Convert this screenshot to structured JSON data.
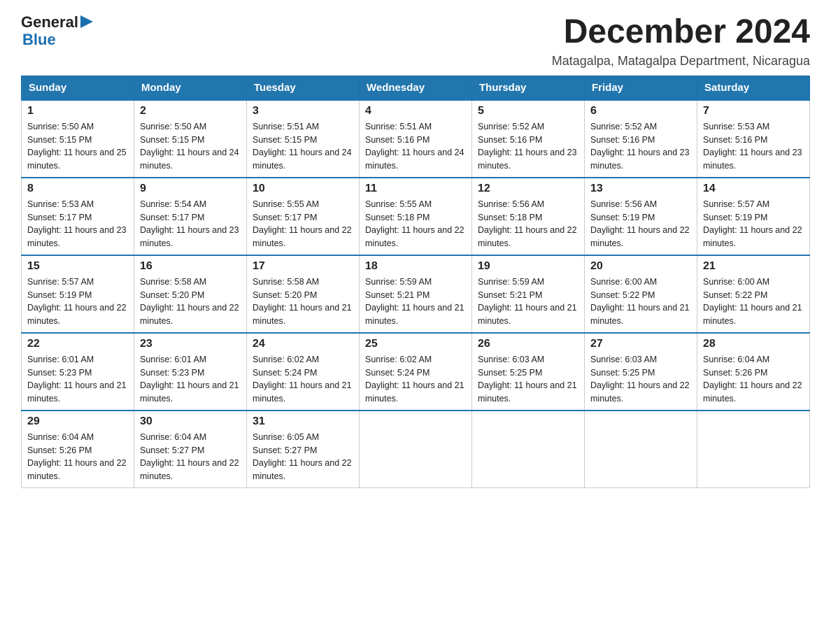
{
  "logo": {
    "text_general": "General",
    "arrow": "▶",
    "text_blue": "Blue"
  },
  "header": {
    "title": "December 2024",
    "subtitle": "Matagalpa, Matagalpa Department, Nicaragua"
  },
  "days_of_week": [
    "Sunday",
    "Monday",
    "Tuesday",
    "Wednesday",
    "Thursday",
    "Friday",
    "Saturday"
  ],
  "weeks": [
    [
      {
        "day": "1",
        "sunrise": "5:50 AM",
        "sunset": "5:15 PM",
        "daylight": "11 hours and 25 minutes."
      },
      {
        "day": "2",
        "sunrise": "5:50 AM",
        "sunset": "5:15 PM",
        "daylight": "11 hours and 24 minutes."
      },
      {
        "day": "3",
        "sunrise": "5:51 AM",
        "sunset": "5:15 PM",
        "daylight": "11 hours and 24 minutes."
      },
      {
        "day": "4",
        "sunrise": "5:51 AM",
        "sunset": "5:16 PM",
        "daylight": "11 hours and 24 minutes."
      },
      {
        "day": "5",
        "sunrise": "5:52 AM",
        "sunset": "5:16 PM",
        "daylight": "11 hours and 23 minutes."
      },
      {
        "day": "6",
        "sunrise": "5:52 AM",
        "sunset": "5:16 PM",
        "daylight": "11 hours and 23 minutes."
      },
      {
        "day": "7",
        "sunrise": "5:53 AM",
        "sunset": "5:16 PM",
        "daylight": "11 hours and 23 minutes."
      }
    ],
    [
      {
        "day": "8",
        "sunrise": "5:53 AM",
        "sunset": "5:17 PM",
        "daylight": "11 hours and 23 minutes."
      },
      {
        "day": "9",
        "sunrise": "5:54 AM",
        "sunset": "5:17 PM",
        "daylight": "11 hours and 23 minutes."
      },
      {
        "day": "10",
        "sunrise": "5:55 AM",
        "sunset": "5:17 PM",
        "daylight": "11 hours and 22 minutes."
      },
      {
        "day": "11",
        "sunrise": "5:55 AM",
        "sunset": "5:18 PM",
        "daylight": "11 hours and 22 minutes."
      },
      {
        "day": "12",
        "sunrise": "5:56 AM",
        "sunset": "5:18 PM",
        "daylight": "11 hours and 22 minutes."
      },
      {
        "day": "13",
        "sunrise": "5:56 AM",
        "sunset": "5:19 PM",
        "daylight": "11 hours and 22 minutes."
      },
      {
        "day": "14",
        "sunrise": "5:57 AM",
        "sunset": "5:19 PM",
        "daylight": "11 hours and 22 minutes."
      }
    ],
    [
      {
        "day": "15",
        "sunrise": "5:57 AM",
        "sunset": "5:19 PM",
        "daylight": "11 hours and 22 minutes."
      },
      {
        "day": "16",
        "sunrise": "5:58 AM",
        "sunset": "5:20 PM",
        "daylight": "11 hours and 22 minutes."
      },
      {
        "day": "17",
        "sunrise": "5:58 AM",
        "sunset": "5:20 PM",
        "daylight": "11 hours and 21 minutes."
      },
      {
        "day": "18",
        "sunrise": "5:59 AM",
        "sunset": "5:21 PM",
        "daylight": "11 hours and 21 minutes."
      },
      {
        "day": "19",
        "sunrise": "5:59 AM",
        "sunset": "5:21 PM",
        "daylight": "11 hours and 21 minutes."
      },
      {
        "day": "20",
        "sunrise": "6:00 AM",
        "sunset": "5:22 PM",
        "daylight": "11 hours and 21 minutes."
      },
      {
        "day": "21",
        "sunrise": "6:00 AM",
        "sunset": "5:22 PM",
        "daylight": "11 hours and 21 minutes."
      }
    ],
    [
      {
        "day": "22",
        "sunrise": "6:01 AM",
        "sunset": "5:23 PM",
        "daylight": "11 hours and 21 minutes."
      },
      {
        "day": "23",
        "sunrise": "6:01 AM",
        "sunset": "5:23 PM",
        "daylight": "11 hours and 21 minutes."
      },
      {
        "day": "24",
        "sunrise": "6:02 AM",
        "sunset": "5:24 PM",
        "daylight": "11 hours and 21 minutes."
      },
      {
        "day": "25",
        "sunrise": "6:02 AM",
        "sunset": "5:24 PM",
        "daylight": "11 hours and 21 minutes."
      },
      {
        "day": "26",
        "sunrise": "6:03 AM",
        "sunset": "5:25 PM",
        "daylight": "11 hours and 21 minutes."
      },
      {
        "day": "27",
        "sunrise": "6:03 AM",
        "sunset": "5:25 PM",
        "daylight": "11 hours and 22 minutes."
      },
      {
        "day": "28",
        "sunrise": "6:04 AM",
        "sunset": "5:26 PM",
        "daylight": "11 hours and 22 minutes."
      }
    ],
    [
      {
        "day": "29",
        "sunrise": "6:04 AM",
        "sunset": "5:26 PM",
        "daylight": "11 hours and 22 minutes."
      },
      {
        "day": "30",
        "sunrise": "6:04 AM",
        "sunset": "5:27 PM",
        "daylight": "11 hours and 22 minutes."
      },
      {
        "day": "31",
        "sunrise": "6:05 AM",
        "sunset": "5:27 PM",
        "daylight": "11 hours and 22 minutes."
      },
      null,
      null,
      null,
      null
    ]
  ]
}
